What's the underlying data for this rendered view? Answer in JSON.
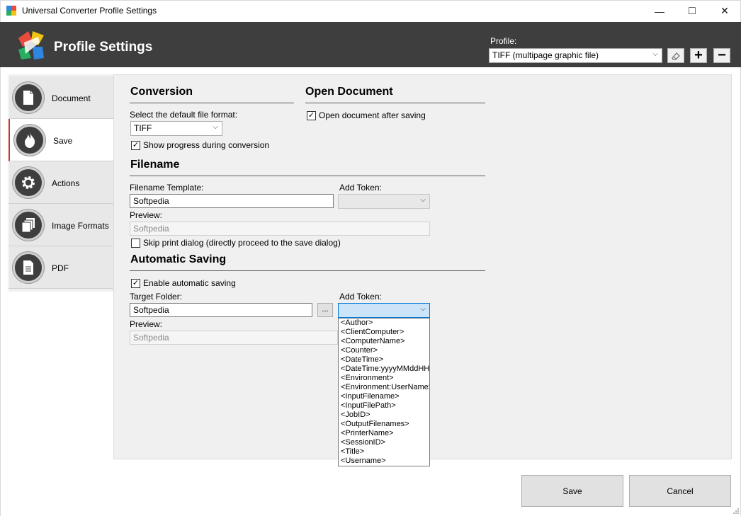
{
  "window": {
    "title": "Universal Converter Profile Settings",
    "minimize_glyph": "—",
    "maximize_glyph": "□",
    "close_glyph": "✕"
  },
  "header": {
    "title": "Profile Settings",
    "profile_label": "Profile:",
    "profile_value": "TIFF (multipage graphic file)",
    "add_glyph": "+",
    "remove_glyph": "−"
  },
  "nav": {
    "items": [
      {
        "label": "Document",
        "icon": "document-icon"
      },
      {
        "label": "Save",
        "icon": "flame-icon"
      },
      {
        "label": "Actions",
        "icon": "gear-icon"
      },
      {
        "label": "Image Formats",
        "icon": "image-stack-icon"
      },
      {
        "label": "PDF",
        "icon": "pdf-doc-icon"
      }
    ],
    "active": "Save"
  },
  "conversion": {
    "title": "Conversion",
    "format_label": "Select the default file format:",
    "format_value": "TIFF",
    "show_progress_label": "Show progress during conversion",
    "show_progress_checked": true
  },
  "open_document": {
    "title": "Open Document",
    "open_after_label": "Open document after saving",
    "open_after_checked": true
  },
  "filename": {
    "title": "Filename",
    "template_label": "Filename Template:",
    "template_value": "Softpedia",
    "add_token_label": "Add Token:",
    "preview_label": "Preview:",
    "preview_value": "Softpedia",
    "skip_print_label": "Skip print dialog (directly proceed to the save dialog)",
    "skip_print_checked": false
  },
  "auto_saving": {
    "title": "Automatic Saving",
    "enable_label": "Enable automatic saving",
    "enable_checked": true,
    "target_label": "Target Folder:",
    "target_value": "Softpedia",
    "browse_label": "...",
    "add_token_label": "Add Token:",
    "preview_label": "Preview:",
    "preview_value": "Softpedia"
  },
  "token_dropdown": {
    "items": [
      "<Author>",
      "<ClientComputer>",
      "<ComputerName>",
      "<Counter>",
      "<DateTime>",
      "<DateTime:yyyyMMddHHmmss>",
      "<Environment>",
      "<Environment:UserName>",
      "<InputFilename>",
      "<InputFilePath>",
      "<JobID>",
      "<OutputFilenames>",
      "<PrinterName>",
      "<SessionID>",
      "<Title>",
      "<Username>"
    ]
  },
  "footer": {
    "save_label": "Save",
    "cancel_label": "Cancel"
  },
  "colors": {
    "header_bg": "#3e3e3e",
    "panel_bg": "#f0f0f0",
    "active_accent": "#c0392b",
    "combo_highlight": "#cce4f7"
  }
}
